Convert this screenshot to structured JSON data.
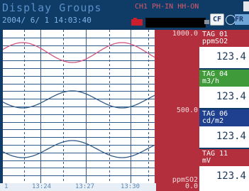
{
  "header": {
    "title": "Display Groups",
    "datetime": "2004/ 6/ 1 14:03:40",
    "status": "CH1  PH-IN  HH-ON",
    "cf_label": "CF",
    "fr_label": "FR"
  },
  "scale": {
    "top": "1000.0",
    "mid": "500.0",
    "unit": "ppmSO2",
    "bottom": "0.0"
  },
  "time_axis": {
    "labels": [
      "1",
      "13:24",
      "13:27",
      "13:30"
    ]
  },
  "tags": [
    {
      "name": "TAG 01",
      "unit": "ppmSO2",
      "value": "123.4",
      "color": "#b32f3e"
    },
    {
      "name": "TAG 04",
      "unit": "m3/h",
      "value": "123.4",
      "color": "#3f9a3a"
    },
    {
      "name": "TAG 06",
      "unit": "cd/m2",
      "value": "123.4",
      "color": "#1f3f8f"
    },
    {
      "name": "TAG 11",
      "unit": "mV",
      "value": "123.4",
      "color": "#b32f3e"
    }
  ],
  "chart_data": {
    "type": "line",
    "series": [
      {
        "color": "#d2567f"
      },
      {
        "color": "#2f5a86"
      },
      {
        "color": "#2f5a86"
      }
    ]
  }
}
